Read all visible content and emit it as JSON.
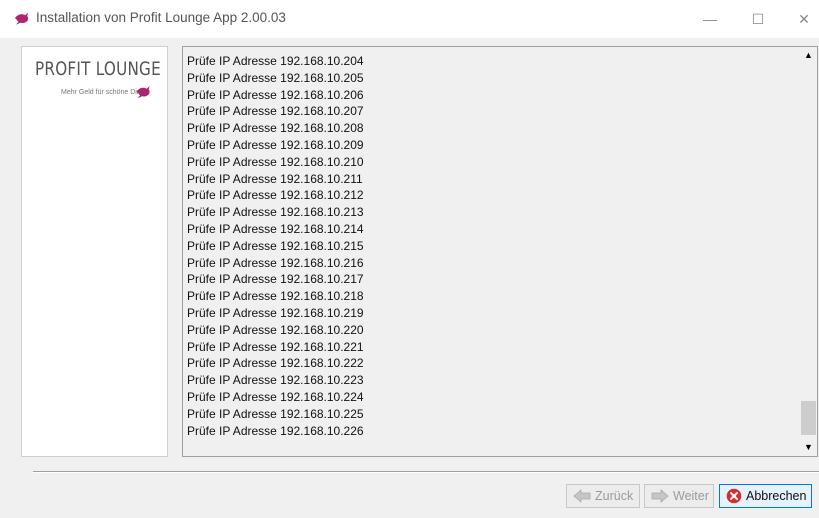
{
  "window": {
    "title": "Installation von Profit Lounge App 2.00.03",
    "minimize_symbol": "—",
    "maximize_symbol": "☐",
    "close_symbol": "✕"
  },
  "logo": {
    "title": "PROFIT LOUNGE",
    "tagline": "Mehr Geld für schöne Dinge"
  },
  "log": {
    "lines": [
      "Prüfe IP Adresse 192.168.10.204",
      "Prüfe IP Adresse 192.168.10.205",
      "Prüfe IP Adresse 192.168.10.206",
      "Prüfe IP Adresse 192.168.10.207",
      "Prüfe IP Adresse 192.168.10.208",
      "Prüfe IP Adresse 192.168.10.209",
      "Prüfe IP Adresse 192.168.10.210",
      "Prüfe IP Adresse 192.168.10.211",
      "Prüfe IP Adresse 192.168.10.212",
      "Prüfe IP Adresse 192.168.10.213",
      "Prüfe IP Adresse 192.168.10.214",
      "Prüfe IP Adresse 192.168.10.215",
      "Prüfe IP Adresse 192.168.10.216",
      "Prüfe IP Adresse 192.168.10.217",
      "Prüfe IP Adresse 192.168.10.218",
      "Prüfe IP Adresse 192.168.10.219",
      "Prüfe IP Adresse 192.168.10.220",
      "Prüfe IP Adresse 192.168.10.221",
      "Prüfe IP Adresse 192.168.10.222",
      "Prüfe IP Adresse 192.168.10.223",
      "Prüfe IP Adresse 192.168.10.224",
      "Prüfe IP Adresse 192.168.10.225",
      "Prüfe IP Adresse 192.168.10.226"
    ],
    "scroll_up_symbol": "▲",
    "scroll_down_symbol": "▼"
  },
  "buttons": {
    "back_label": "Zurück",
    "next_label": "Weiter",
    "cancel_label": "Abbrechen"
  },
  "colors": {
    "brand": "#b0236f",
    "focus_border": "#0078d7",
    "cancel_icon": "#d92b2b"
  }
}
